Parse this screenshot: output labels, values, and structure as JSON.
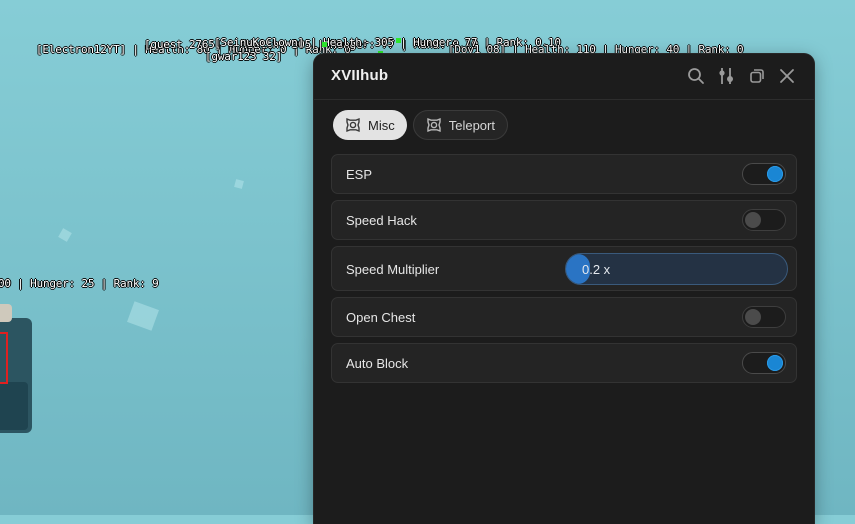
{
  "world": {
    "esp_tags": [
      "[Electron12YT] | Health: 80 | Hunger: 0 | Rank: 0",
      "[guest 2765] | Health: 305 | Hunger: 77 | Rank: 0.10",
      "[SeinuKoClown] | Health: 305 | Hunger: 77 | Rank: 0.10",
      "[Dov1 08] | Health: 110 | Hunger: 40 | Rank: 0",
      "[gwar123 32]",
      "00 | Hunger: 25 | Rank: 9"
    ],
    "esp_box_color": "#e02020",
    "esp_dot_color": "#2ee82e"
  },
  "window": {
    "title": "XVIIhub",
    "icons": [
      "search-icon",
      "sliders-icon",
      "minimize-icon",
      "close-icon"
    ]
  },
  "tabs": [
    {
      "label": "Misc",
      "active": true,
      "icon": "gamepad-icon"
    },
    {
      "label": "Teleport",
      "active": false,
      "icon": "gamepad-icon"
    }
  ],
  "options": [
    {
      "label": "ESP",
      "type": "toggle",
      "value": true
    },
    {
      "label": "Speed Hack",
      "type": "toggle",
      "value": false
    },
    {
      "label": "Speed Multiplier",
      "type": "slider",
      "value_text": "0.2 x",
      "fraction": 0.1
    },
    {
      "label": "Open Chest",
      "type": "toggle",
      "value": false
    },
    {
      "label": "Auto Block",
      "type": "toggle",
      "value": true
    }
  ],
  "colors": {
    "accent": "#1a86d4",
    "panel_bg": "#1c1c1c",
    "row_bg": "#242424"
  }
}
